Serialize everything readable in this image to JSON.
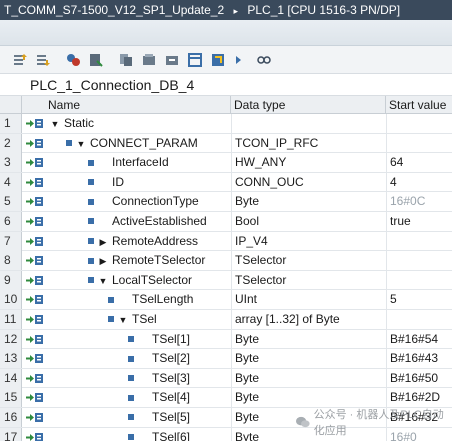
{
  "titlebar": {
    "project": "T_COMM_S7-1500_V12_SP1_Update_2",
    "separator": "▸",
    "device": "PLC_1 [CPU 1516-3 PN/DP]"
  },
  "toolbar": {
    "icons": [
      "insert-row-icon",
      "add-row-icon",
      "keep-values-icon",
      "snapshot-icon",
      "copy-snapshot-icon",
      "load-start-values-icon",
      "initialize-icon",
      "monitor-icon",
      "expand-icon",
      "settings-icon",
      "glasses-icon"
    ]
  },
  "block": {
    "name": "PLC_1_Connection_DB_4"
  },
  "columns": {
    "name": "Name",
    "datatype": "Data type",
    "startvalue": "Start value"
  },
  "rows": [
    {
      "no": "1",
      "name": "Static",
      "type": "",
      "start": ""
    },
    {
      "no": "2",
      "name": "CONNECT_PARAM",
      "type": "TCON_IP_RFC",
      "start": ""
    },
    {
      "no": "3",
      "name": "InterfaceId",
      "type": "HW_ANY",
      "start": "64"
    },
    {
      "no": "4",
      "name": "ID",
      "type": "CONN_OUC",
      "start": "4"
    },
    {
      "no": "5",
      "name": "ConnectionType",
      "type": "Byte",
      "start": "16#0C"
    },
    {
      "no": "6",
      "name": "ActiveEstablished",
      "type": "Bool",
      "start": "true"
    },
    {
      "no": "7",
      "name": "RemoteAddress",
      "type": "IP_V4",
      "start": ""
    },
    {
      "no": "8",
      "name": "RemoteTSelector",
      "type": "TSelector",
      "start": ""
    },
    {
      "no": "9",
      "name": "LocalTSelector",
      "type": "TSelector",
      "start": ""
    },
    {
      "no": "10",
      "name": "TSelLength",
      "type": "UInt",
      "start": "5"
    },
    {
      "no": "11",
      "name": "TSel",
      "type": "array [1..32] of Byte",
      "start": ""
    },
    {
      "no": "12",
      "name": "TSel[1]",
      "type": "Byte",
      "start": "B#16#54"
    },
    {
      "no": "13",
      "name": "TSel[2]",
      "type": "Byte",
      "start": "B#16#43"
    },
    {
      "no": "14",
      "name": "TSel[3]",
      "type": "Byte",
      "start": "B#16#50"
    },
    {
      "no": "15",
      "name": "TSel[4]",
      "type": "Byte",
      "start": "B#16#2D"
    },
    {
      "no": "16",
      "name": "TSel[5]",
      "type": "Byte",
      "start": "B#16#32"
    },
    {
      "no": "17",
      "name": "TSel[6]",
      "type": "Byte",
      "start": "16#0"
    }
  ],
  "watermark": {
    "text": "公众号 · 机器人及PLC自动化应用"
  },
  "colors": {
    "titlebar": "#3a4a5c",
    "accent": "#3a6ea8",
    "iconGreen": "#2f8a3e"
  }
}
